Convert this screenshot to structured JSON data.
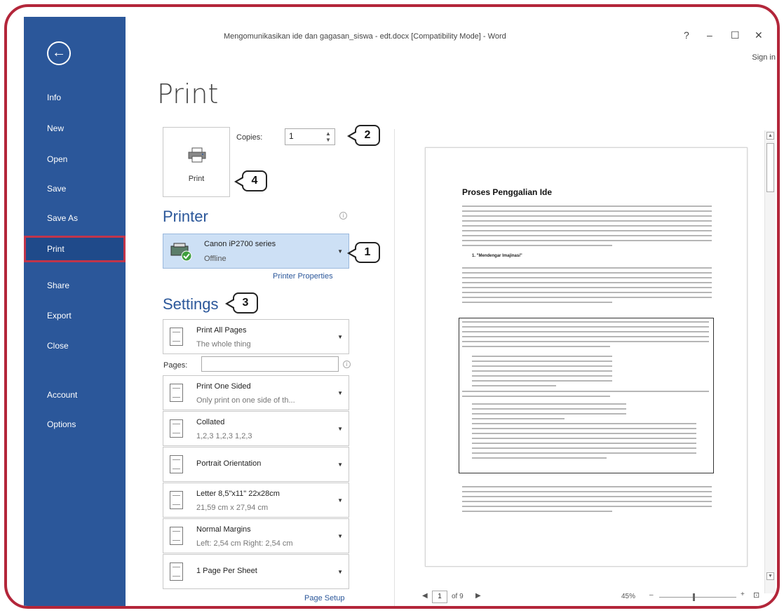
{
  "window": {
    "title": "Mengomunikasikan ide dan gagasan_siswa - edt.docx [Compatibility Mode] - Word",
    "help": "?",
    "minimize": "–",
    "maximize": "☐",
    "close": "✕",
    "sign_in": "Sign in"
  },
  "sidebar": {
    "back_icon": "back-arrow-icon",
    "items": [
      {
        "label": "Info"
      },
      {
        "label": "New"
      },
      {
        "label": "Open"
      },
      {
        "label": "Save"
      },
      {
        "label": "Save As"
      },
      {
        "label": "Print",
        "active": true
      },
      {
        "label": "Share"
      },
      {
        "label": "Export"
      },
      {
        "label": "Close"
      },
      {
        "label": "Account"
      },
      {
        "label": "Options"
      }
    ]
  },
  "print": {
    "page_title": "Print",
    "button_label": "Print",
    "copies_label": "Copies:",
    "copies_value": "1"
  },
  "printer": {
    "heading": "Printer",
    "name": "Canon iP2700 series",
    "status": "Offline",
    "properties_link": "Printer Properties"
  },
  "settings": {
    "heading": "Settings",
    "pages_label": "Pages:",
    "items": [
      {
        "title": "Print All Pages",
        "subtitle": "The whole thing"
      },
      {
        "title": "Print One Sided",
        "subtitle": "Only print on one side of th..."
      },
      {
        "title": "Collated",
        "subtitle": "1,2,3   1,2,3   1,2,3"
      },
      {
        "title": "Portrait Orientation",
        "subtitle": ""
      },
      {
        "title": "Letter 8,5\"x11\" 22x28cm",
        "subtitle": "21,59 cm x 27,94 cm"
      },
      {
        "title": "Normal Margins",
        "subtitle": "Left:  2,54 cm    Right: 2,54 cm"
      },
      {
        "title": "1 Page Per Sheet",
        "subtitle": ""
      }
    ],
    "page_setup_link": "Page Setup"
  },
  "preview": {
    "doc_title": "Proses Penggalian Ide",
    "doc_subheading": "1.  \"Mendengar Imajinasi\"",
    "current_page": "1",
    "page_of": "of 9",
    "zoom": "45%"
  },
  "callouts": [
    "1",
    "2",
    "3",
    "4"
  ],
  "colors": {
    "sidebar": "#2b579a",
    "accent": "#2b579a",
    "frame": "#b3263a",
    "highlight": "#c0354b"
  }
}
